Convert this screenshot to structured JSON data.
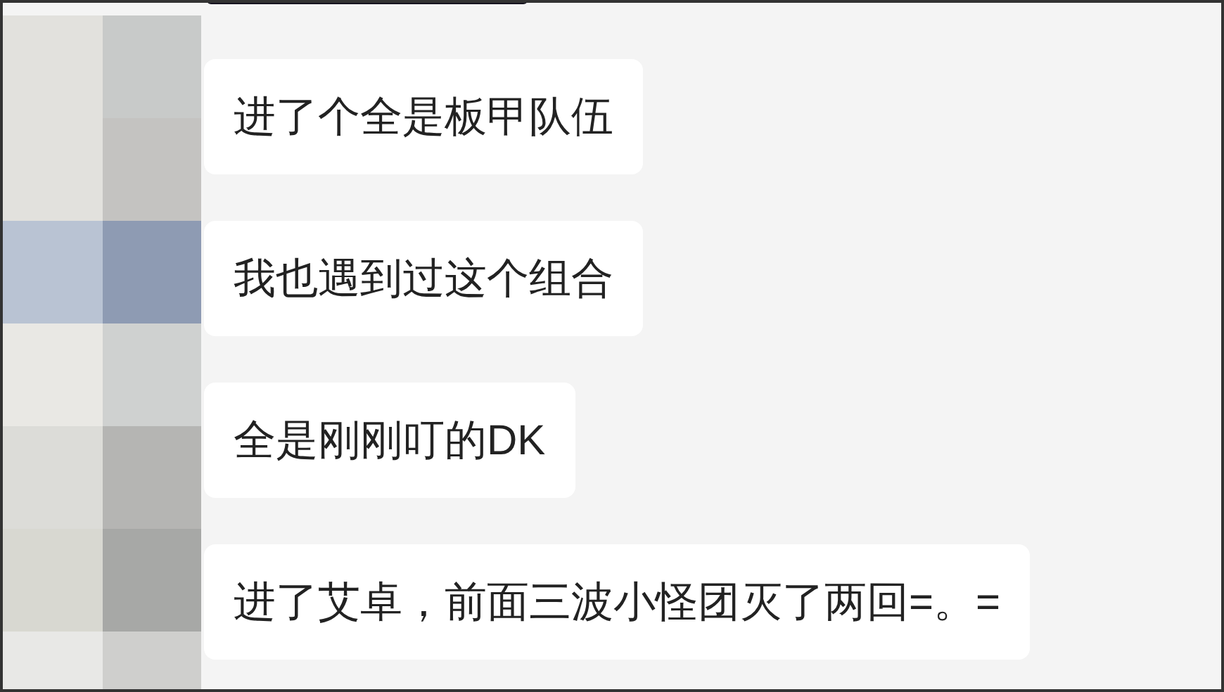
{
  "messages": [
    {
      "text": "进了个全是板甲队伍"
    },
    {
      "text": "我也遇到过这个组合"
    },
    {
      "text": "全是刚刚叮的DK"
    },
    {
      "text": "进了艾卓，前面三波小怪团灭了两回=。="
    }
  ]
}
